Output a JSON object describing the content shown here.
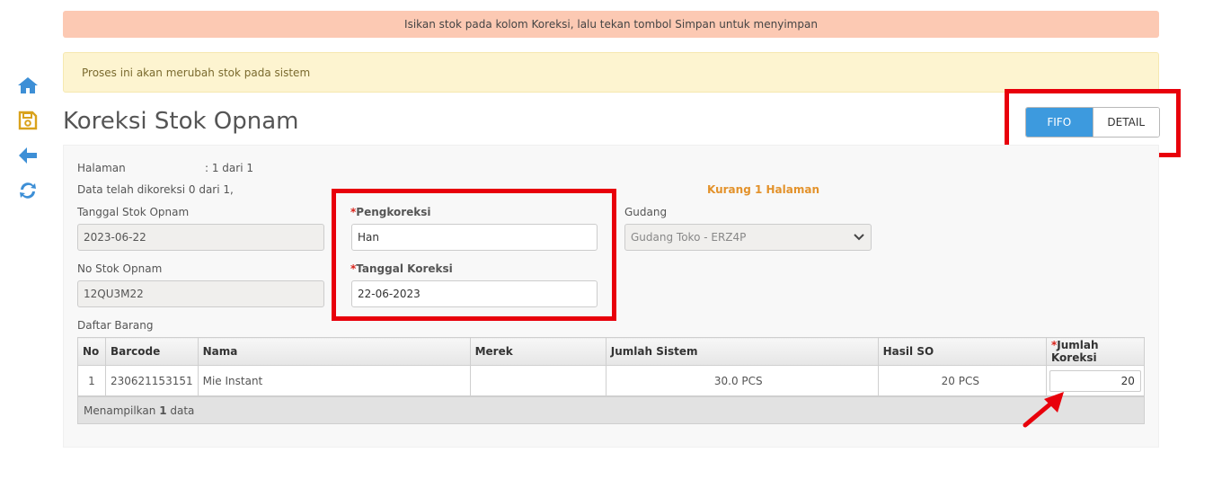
{
  "alerts": {
    "info": "Isikan stok pada kolom Koreksi, lalu tekan tombol Simpan untuk menyimpan",
    "warning": "Proses ini akan merubah stok pada sistem"
  },
  "page_title": "Koreksi Stok Opnam",
  "toggle": {
    "fifo": "FIFO",
    "detail": "DETAIL",
    "active": "FIFO"
  },
  "sidebar": {
    "icons": [
      "home-icon",
      "save-icon",
      "back-arrow-icon",
      "refresh-icon"
    ],
    "colors": {
      "blue": "#3d8fd6",
      "gold": "#d9a21c"
    }
  },
  "info": {
    "halaman_label": "Halaman",
    "halaman_value": ": 1 dari 1",
    "corrected_text": "Data telah dikoreksi 0 dari 1,",
    "kurang_text": "Kurang 1 Halaman"
  },
  "form": {
    "tanggal_so_label": "Tanggal Stok Opnam",
    "tanggal_so_value": "2023-06-22",
    "no_so_label": "No Stok Opnam",
    "no_so_value": "12QU3M22",
    "pengkoreksi_label": "Pengkoreksi",
    "pengkoreksi_value": "Han",
    "tanggal_koreksi_label": "Tanggal Koreksi",
    "tanggal_koreksi_value": "22-06-2023",
    "gudang_label": "Gudang",
    "gudang_value": "Gudang Toko - ERZ4P",
    "required_mark": "*"
  },
  "table": {
    "caption": "Daftar Barang",
    "headers": [
      "No",
      "Barcode",
      "Nama",
      "Merek",
      "Jumlah Sistem",
      "Hasil SO",
      "Jumlah Koreksi"
    ],
    "rows": [
      {
        "no": "1",
        "barcode": "230621153151",
        "nama": "Mie Instant",
        "merek": "",
        "jumlah_sistem": "30.0 PCS",
        "hasil_so": "20 PCS",
        "jumlah_koreksi": "20"
      }
    ],
    "footer_prefix": "Menampilkan ",
    "footer_count": "1",
    "footer_suffix": " data"
  }
}
